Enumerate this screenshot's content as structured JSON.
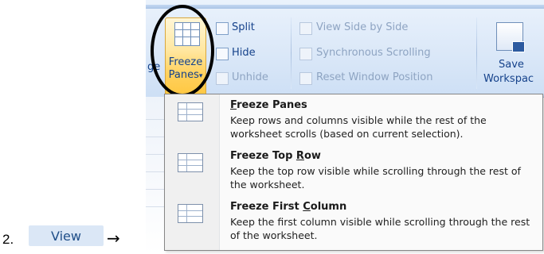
{
  "step": {
    "number": "2.",
    "tab_label": "View",
    "arrow": "→"
  },
  "ribbon": {
    "clipped_label": "ge",
    "freeze_panes": {
      "line1": "Freeze",
      "line2": "Panes",
      "caret": "▾"
    },
    "split": "Split",
    "hide": "Hide",
    "unhide": "Unhide",
    "view_side_by_side": "View Side by Side",
    "synchronous_scrolling": "Synchronous Scrolling",
    "reset_window_position": "Reset Window Position",
    "save_workspace": {
      "line1": "Save",
      "line2": "Workspac"
    }
  },
  "menu": {
    "items": [
      {
        "title_prefix": "",
        "title_key": "F",
        "title_rest": "reeze Panes",
        "description": "Keep rows and columns visible while the rest of the worksheet scrolls (based on current selection)."
      },
      {
        "title_prefix": "Freeze Top ",
        "title_key": "R",
        "title_rest": "ow",
        "description": "Keep the top row visible while scrolling through the rest of the worksheet."
      },
      {
        "title_prefix": "Freeze First ",
        "title_key": "C",
        "title_rest": "olumn",
        "description": "Keep the first column visible while scrolling through the rest of the worksheet."
      }
    ]
  },
  "icons": {
    "freeze_panes": "freeze-panes-icon",
    "split": "split-icon",
    "hide": "hide-icon",
    "unhide": "unhide-icon",
    "view_side_by_side": "view-side-by-side-icon",
    "synchronous_scrolling": "synchronous-scrolling-icon",
    "reset_window_position": "reset-window-position-icon",
    "save_workspace": "save-workspace-icon"
  },
  "colors": {
    "ribbon_text": "#15428b",
    "active_button": "#ffd05b",
    "menu_bg": "#fafafa"
  }
}
